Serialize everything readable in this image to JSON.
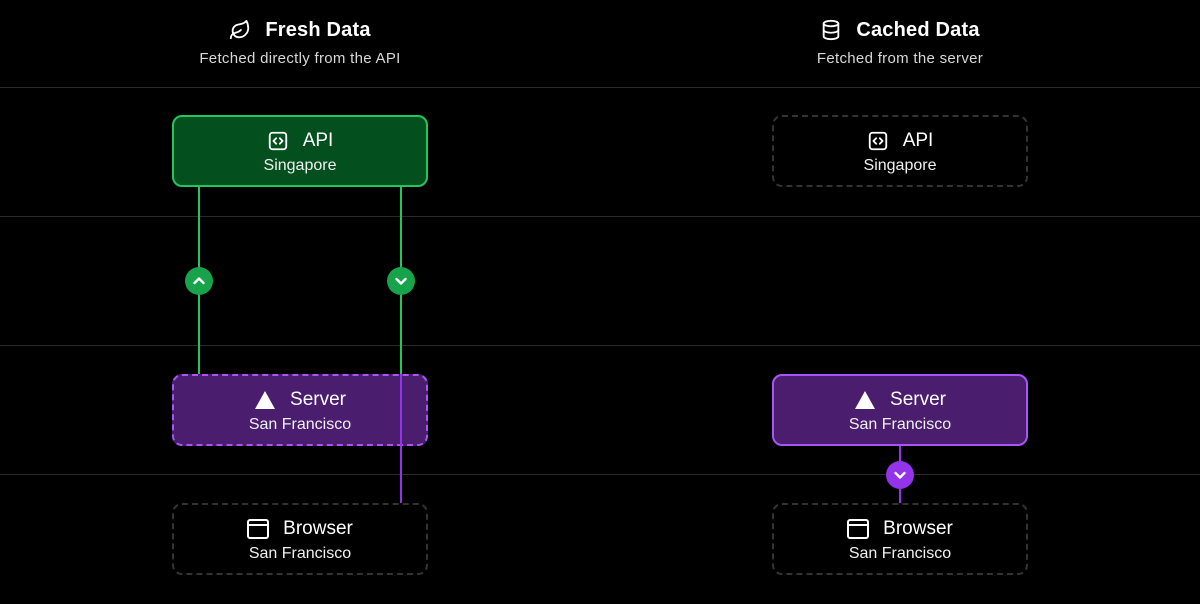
{
  "columns": {
    "fresh": {
      "title": "Fresh Data",
      "subtitle": "Fetched directly from the API",
      "icon": "leaf-icon"
    },
    "cached": {
      "title": "Cached Data",
      "subtitle": "Fetched from the server",
      "icon": "database-icon"
    }
  },
  "fresh": {
    "api": {
      "title": "API",
      "location": "Singapore",
      "icon": "code-icon",
      "state": "active"
    },
    "server": {
      "title": "Server",
      "location": "San Francisco",
      "icon": "triangle-icon",
      "state": "pass-through"
    },
    "browser": {
      "title": "Browser",
      "location": "San Francisco",
      "icon": "browser-window-icon",
      "state": "inactive"
    },
    "arrows": [
      "up",
      "down"
    ]
  },
  "cached": {
    "api": {
      "title": "API",
      "location": "Singapore",
      "icon": "code-icon",
      "state": "inactive"
    },
    "server": {
      "title": "Server",
      "location": "San Francisco",
      "icon": "triangle-icon",
      "state": "active"
    },
    "browser": {
      "title": "Browser",
      "location": "San Francisco",
      "icon": "browser-window-icon",
      "state": "inactive"
    },
    "arrows": [
      "down"
    ]
  },
  "colors": {
    "background": "#000000",
    "green_fill": "#03501e",
    "green_stroke": "#22c55e",
    "purple_fill": "#4a1d6e",
    "purple_stroke": "#a855f7",
    "inactive_stroke": "#333333",
    "grid_line": "#2a2a2a"
  }
}
